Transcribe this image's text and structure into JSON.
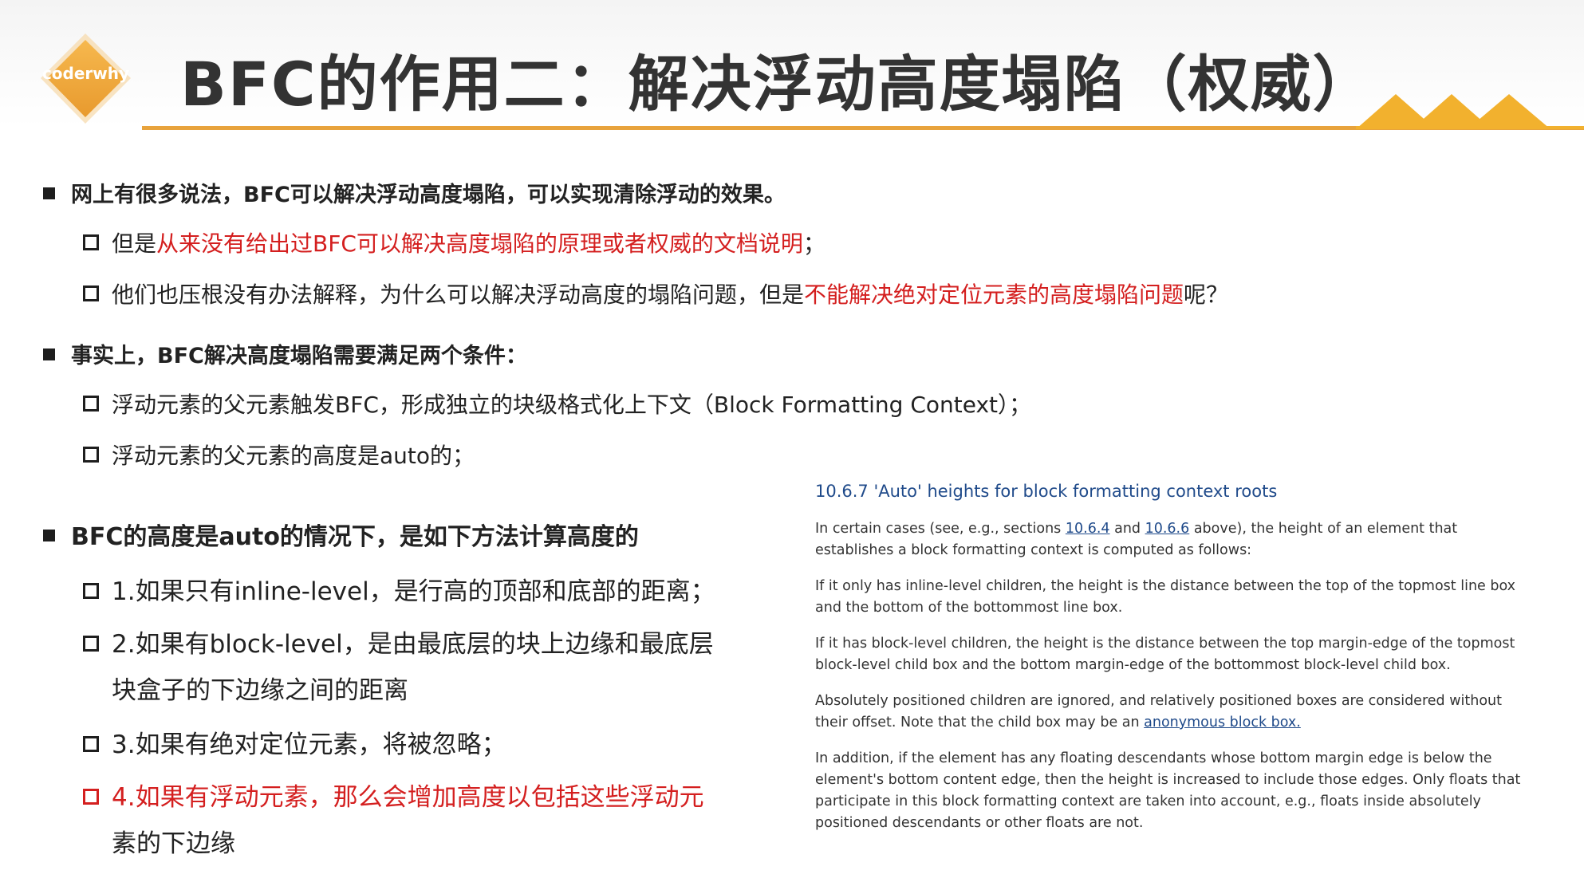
{
  "header": {
    "logo_text": "coderwhy",
    "title": "BFC的作用二：解决浮动高度塌陷（权威）",
    "accent_color": "#e8a33c"
  },
  "bullets": {
    "b1": {
      "text": "网上有很多说法，BFC可以解决浮动高度塌陷，可以实现清除浮动的效果。",
      "sub1": {
        "prefix": "但是",
        "red": "从来没有给出过BFC可以解决高度塌陷的原理或者权威的文档说明",
        "suffix": "；"
      },
      "sub2": {
        "prefix": "他们也压根没有办法解释，为什么可以解决浮动高度的塌陷问题，但是",
        "red": "不能解决绝对定位元素的高度塌陷问题",
        "suffix": "呢？"
      }
    },
    "b2": {
      "text": "事实上，BFC解决高度塌陷需要满足两个条件：",
      "sub1": "浮动元素的父元素触发BFC，形成独立的块级格式化上下文（Block Formatting Context）；",
      "sub2": "浮动元素的父元素的高度是auto的；"
    },
    "b3": {
      "text": "BFC的高度是auto的情况下，是如下方法计算高度的",
      "sub1": "1.如果只有inline-level，是行高的顶部和底部的距离；",
      "sub2_line1": "2.如果有block-level，是由最底层的块上边缘和最底层",
      "sub2_line2": "块盒子的下边缘之间的距离",
      "sub3": "3.如果有绝对定位元素，将被忽略；",
      "sub4_line1": "4.如果有浮动元素，那么会增加高度以包括这些浮动元",
      "sub4_line2": "素的下边缘"
    }
  },
  "spec": {
    "heading": "10.6.7 'Auto' heights for block formatting context roots",
    "p1_a": "In certain cases (see, e.g., sections ",
    "p1_link1": "10.6.4",
    "p1_b": " and ",
    "p1_link2": "10.6.6",
    "p1_c": " above), the height of an element that establishes a block formatting context is computed as follows:",
    "p2": "If it only has inline-level children, the height is the distance between the top of the topmost line box and the bottom of the bottommost line box.",
    "p3": "If it has block-level children, the height is the distance between the top margin-edge of the topmost block-level child box and the bottom margin-edge of the bottommost block-level child box.",
    "p4_a": "Absolutely positioned children are ignored, and relatively positioned boxes are considered without their offset. Note that the child box may be an ",
    "p4_link": "anonymous block box.",
    "p5": "In addition, if the element has any floating descendants whose bottom margin edge is below the element's bottom content edge, then the height is increased to include those edges. Only floats that participate in this block formatting context are taken into account, e.g., floats inside absolutely positioned descendants or other floats are not."
  }
}
